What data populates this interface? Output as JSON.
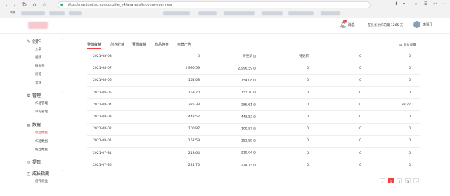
{
  "browser": {
    "url": "https://mp.toutiao.com/profile_v4/analysis/income-overview",
    "bookmarks_label": "收藏"
  },
  "header": {
    "message_label": "消息",
    "message_badge": "2",
    "days_text": "在头条创作的第 1265 天",
    "user_name": "表哥几"
  },
  "sidebar": {
    "groups": [
      {
        "label": "创作",
        "items": [
          "文章",
          "视频",
          "微头条",
          "问答",
          "音频"
        ]
      },
      {
        "label": "管理",
        "items": [
          "作品管理",
          "评论管理"
        ]
      },
      {
        "label": "数据",
        "items": [
          "收益数据",
          "作品数据",
          "粉丝数据"
        ],
        "active": "收益数据"
      },
      {
        "label": "提现",
        "items": []
      },
      {
        "label": "成长指南",
        "items": [
          "创作权益"
        ]
      }
    ]
  },
  "tabs": [
    "整体收益",
    "创作收益",
    "赞赏收益",
    "商品佣金",
    "自营广告"
  ],
  "active_tab": "整体收益",
  "settings_label": "收益设置",
  "rows": [
    {
      "date": "2021-08-08",
      "c1": "0",
      "c2": "待更新",
      "c3": "待更新",
      "c4": "0",
      "c5": "0"
    },
    {
      "date": "2021-08-07",
      "c1": "2,996.59",
      "c2": "2,996.59",
      "c3": "0",
      "c4": "0",
      "c5": "0"
    },
    {
      "date": "2021-08-06",
      "c1": "154.08",
      "c2": "154.08",
      "c3": "0",
      "c4": "0",
      "c5": "0"
    },
    {
      "date": "2021-08-05",
      "c1": "153.70",
      "c2": "153.70",
      "c3": "0",
      "c4": "0",
      "c5": "0"
    },
    {
      "date": "2021-08-04",
      "c1": "325.38",
      "c2": "286.61",
      "c3": "0",
      "c4": "0",
      "c5": "38.77"
    },
    {
      "date": "2021-08-03",
      "c1": "443.52",
      "c2": "443.52",
      "c3": "0",
      "c4": "0",
      "c5": "0"
    },
    {
      "date": "2021-08-02",
      "c1": "100.87",
      "c2": "100.87",
      "c3": "0",
      "c4": "0",
      "c5": "0"
    },
    {
      "date": "2021-08-01",
      "c1": "152.59",
      "c2": "152.59",
      "c3": "0",
      "c4": "0",
      "c5": "0"
    },
    {
      "date": "2021-07-31",
      "c1": "218.64",
      "c2": "218.64",
      "c3": "0",
      "c4": "0",
      "c5": "0"
    },
    {
      "date": "2021-07-30",
      "c1": "224.75",
      "c2": "224.75",
      "c3": "0",
      "c4": "0",
      "c5": "0"
    }
  ],
  "pagination": {
    "current": "1",
    "pages": [
      "1",
      "2",
      "3"
    ],
    "next": "›",
    "prev": "‹"
  },
  "colors": {
    "accent": "#f04142"
  }
}
